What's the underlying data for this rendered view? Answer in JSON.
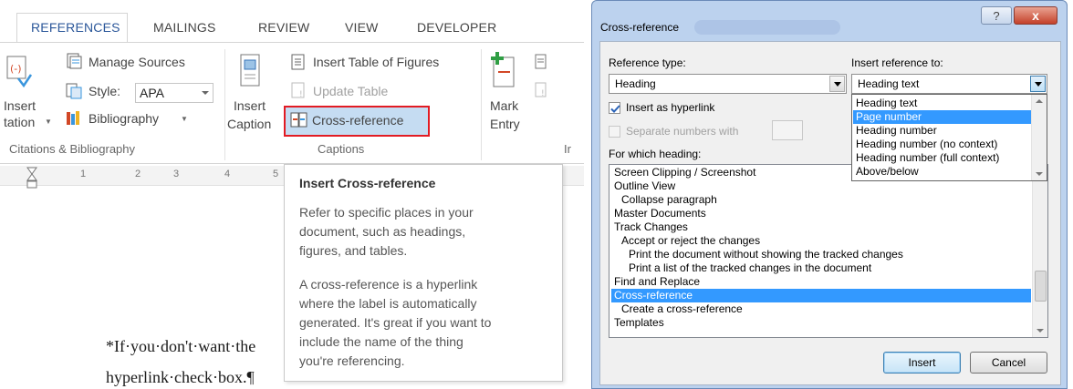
{
  "ribbon": {
    "tabs": [
      "REFERENCES",
      "MAILINGS",
      "REVIEW",
      "VIEW",
      "DEVELOPER"
    ],
    "active_tab": "REFERENCES",
    "citations": {
      "insert_line1": "Insert",
      "insert_line2": "tation",
      "manage_sources": "Manage Sources",
      "style_label": "Style:",
      "style_value": "APA",
      "bibliography": "Bibliography",
      "group_label": "Citations & Bibliography"
    },
    "captions": {
      "insert_caption_line1": "Insert",
      "insert_caption_line2": "Caption",
      "insert_table_of_figures": "Insert Table of Figures",
      "update_table": "Update Table",
      "cross_reference": "Cross-reference",
      "group_label": "Captions"
    },
    "index": {
      "mark_entry_line1": "Mark",
      "mark_entry_line2": "Entry",
      "group_label_partial": "Ir"
    }
  },
  "ruler": [
    "1",
    "2",
    "3",
    "4",
    "5"
  ],
  "document": {
    "line1": "*If·you·don't·want·the",
    "line2": "hyperlink·check·box.¶"
  },
  "tooltip": {
    "title": "Insert Cross-reference",
    "p1_lines": [
      "Refer to specific places in your",
      "document, such as headings,",
      "figures, and tables."
    ],
    "p2_lines": [
      "A cross-reference is a hyperlink",
      "where the label is automatically",
      "generated. It's great if you want to",
      "include the name of the thing",
      "you're referencing."
    ]
  },
  "dialog": {
    "title": "Cross-reference",
    "help_button": "?",
    "close_button": "x",
    "reference_type_label": "Reference type:",
    "reference_type_value": "Heading",
    "insert_reference_to_label": "Insert reference to:",
    "insert_reference_to_value": "Heading text",
    "insert_reference_to_options": [
      "Heading text",
      "Page number",
      "Heading number",
      "Heading number (no context)",
      "Heading number (full  context)",
      "Above/below"
    ],
    "insert_reference_to_highlighted": "Page number",
    "insert_as_hyperlink_label": "Insert as hyperlink",
    "insert_as_hyperlink_checked": true,
    "separate_numbers_label": "Separate numbers with",
    "separate_numbers_checked": false,
    "for_which_heading_label": "For which heading:",
    "headings": [
      {
        "text": "Screen Clipping / Screenshot",
        "level": 0
      },
      {
        "text": "Outline View",
        "level": 0
      },
      {
        "text": "Collapse paragraph",
        "level": 1
      },
      {
        "text": "Master Documents",
        "level": 0
      },
      {
        "text": "Track Changes",
        "level": 0
      },
      {
        "text": "Accept or reject the changes",
        "level": 1
      },
      {
        "text": "Print the document without showing the tracked changes",
        "level": 2
      },
      {
        "text": "Print a list of the tracked changes in the document",
        "level": 2
      },
      {
        "text": "Find and Replace",
        "level": 0
      },
      {
        "text": "Cross-reference",
        "level": 0
      },
      {
        "text": "Create a cross-reference",
        "level": 1
      },
      {
        "text": "Templates",
        "level": 0
      }
    ],
    "selected_heading": "Cross-reference",
    "insert_button": "Insert",
    "cancel_button": "Cancel"
  },
  "colors": {
    "accent": "#2b579a",
    "highlight_red": "#e21b23",
    "selection_blue": "#3399ff",
    "button_hover": "#c5dcf2"
  }
}
